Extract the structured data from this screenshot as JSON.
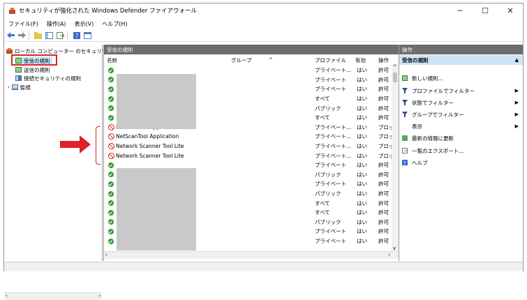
{
  "window": {
    "title": "セキュリティが強化された Windows Defender ファイアウォール",
    "minimize": "─",
    "maximize": "☐",
    "close": "✕"
  },
  "menu": [
    "ファイル(F)",
    "操作(A)",
    "表示(V)",
    "ヘルプ(H)"
  ],
  "tree": {
    "root": "ローカル コンピューター のセキュリティ",
    "items": [
      "受信の規則",
      "送信の規則",
      "接続セキュリティの規則",
      "監視"
    ]
  },
  "center": {
    "header": "受信の規則",
    "columns": [
      "名前",
      "グループ",
      "プロファイル",
      "有効",
      "操作"
    ],
    "rows": [
      {
        "name": "",
        "profile": "プライベート...",
        "enabled": "はい",
        "action": "許可",
        "type": "allow"
      },
      {
        "name": "",
        "profile": "プライベート",
        "enabled": "はい",
        "action": "許可",
        "type": "allow"
      },
      {
        "name": "",
        "profile": "プライベート",
        "enabled": "はい",
        "action": "許可",
        "type": "allow"
      },
      {
        "name": "",
        "profile": "すべて",
        "enabled": "はい",
        "action": "許可",
        "type": "allow"
      },
      {
        "name": "",
        "profile": "パブリック",
        "enabled": "はい",
        "action": "許可",
        "type": "allow"
      },
      {
        "name": "",
        "profile": "すべて",
        "enabled": "はい",
        "action": "許可",
        "type": "allow"
      },
      {
        "name": "NetScanTool Application",
        "profile": "プライベート...",
        "enabled": "はい",
        "action": "ブロッ",
        "type": "block"
      },
      {
        "name": "NetScanTool Application",
        "profile": "プライベート...",
        "enabled": "はい",
        "action": "ブロッ",
        "type": "block"
      },
      {
        "name": "Network Scanner Tool Lite",
        "profile": "プライベート...",
        "enabled": "はい",
        "action": "ブロッ",
        "type": "block"
      },
      {
        "name": "Network Scanner Tool Lite",
        "profile": "プライベート...",
        "enabled": "はい",
        "action": "ブロッ",
        "type": "block"
      },
      {
        "name": "",
        "profile": "プライベート",
        "enabled": "はい",
        "action": "許可",
        "type": "allow"
      },
      {
        "name": "",
        "profile": "パブリック",
        "enabled": "はい",
        "action": "許可",
        "type": "allow"
      },
      {
        "name": "",
        "profile": "プライベート",
        "enabled": "はい",
        "action": "許可",
        "type": "allow"
      },
      {
        "name": "",
        "profile": "パブリック",
        "enabled": "はい",
        "action": "許可",
        "type": "allow"
      },
      {
        "name": "",
        "profile": "すべて",
        "enabled": "はい",
        "action": "許可",
        "type": "allow"
      },
      {
        "name": "",
        "profile": "すべて",
        "enabled": "はい",
        "action": "許可",
        "type": "allow"
      },
      {
        "name": "",
        "profile": "パブリック",
        "enabled": "はい",
        "action": "許可",
        "type": "allow"
      },
      {
        "name": "",
        "profile": "プライベート",
        "enabled": "はい",
        "action": "許可",
        "type": "allow"
      },
      {
        "name": "",
        "profile": "プライベート",
        "enabled": "はい",
        "action": "許可",
        "type": "allow"
      }
    ]
  },
  "actions": {
    "header": "操作",
    "section": "受信の規則",
    "items": [
      {
        "label": "新しい規則...",
        "icon": "new-rule-icon",
        "arrow": false
      },
      {
        "label": "プロファイルでフィルター",
        "icon": "filter-icon",
        "arrow": true
      },
      {
        "label": "状態でフィルター",
        "icon": "filter-icon",
        "arrow": true
      },
      {
        "label": "グループでフィルター",
        "icon": "filter-icon",
        "arrow": true
      },
      {
        "label": "表示",
        "icon": "",
        "arrow": true
      },
      {
        "label": "最新の情報に更新",
        "icon": "refresh-icon",
        "arrow": false
      },
      {
        "label": "一覧のエクスポート...",
        "icon": "export-icon",
        "arrow": false
      },
      {
        "label": "ヘルプ",
        "icon": "help-icon",
        "arrow": false
      }
    ]
  },
  "colors": {
    "accent_red": "#e0202a",
    "allow_green": "#2f9a2f",
    "pane_header": "#6d6d6d",
    "selected": "#cce4f7"
  }
}
